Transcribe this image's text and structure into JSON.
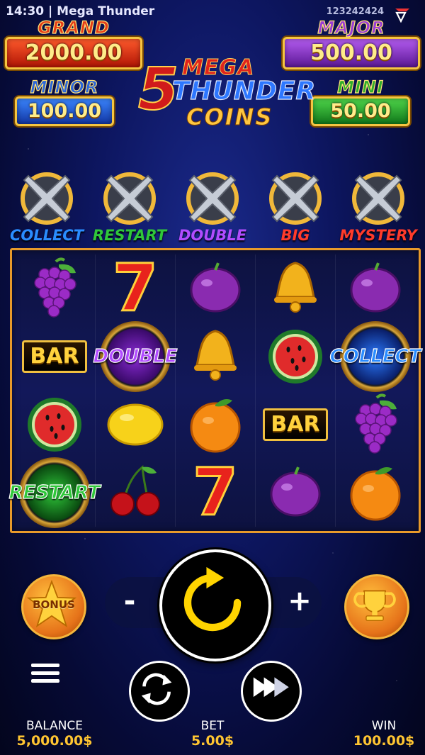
{
  "status_bar": {
    "time_title": "14:30 | Mega Thunder",
    "session_id": "123242424"
  },
  "jackpots": {
    "grand": {
      "label": "GRAND",
      "value": "2000.00",
      "color": "#e53b17"
    },
    "major": {
      "label": "MAJOR",
      "value": "500.00",
      "color": "#9a3cd6"
    },
    "minor": {
      "label": "MINOR",
      "value": "100.00",
      "color": "#2b66d9"
    },
    "mini": {
      "label": "MINI",
      "value": "50.00",
      "color": "#2fae2a"
    }
  },
  "game_logo": {
    "number": "5",
    "line1": "MEGA",
    "line2": "THUNDER",
    "line3": "COINS"
  },
  "features": [
    {
      "label": "COLLECT",
      "color": "#2a8cff"
    },
    {
      "label": "RESTART",
      "color": "#2fc73a"
    },
    {
      "label": "DOUBLE",
      "color": "#b14cff"
    },
    {
      "label": "BIG",
      "color": "#ff3b2b"
    },
    {
      "label": "MYSTERY",
      "color": "#ff3b2b"
    }
  ],
  "reels": [
    [
      "grapes",
      "bar",
      "watermelon",
      "restart-coin"
    ],
    [
      "seven",
      "double-coin",
      "lemon",
      "cherries"
    ],
    [
      "plum",
      "bell",
      "orange",
      "seven"
    ],
    [
      "bell",
      "watermelon",
      "bar",
      "plum"
    ],
    [
      "plum",
      "collect-coin",
      "grapes",
      "orange"
    ]
  ],
  "symbol_text": {
    "bar": "BAR",
    "seven": "7",
    "double": "DOUBLE",
    "collect": "COLLECT",
    "restart": "RESTART"
  },
  "controls": {
    "bonus_label": "BONUS",
    "minus": "-",
    "plus": "+"
  },
  "footer": {
    "balance_label": "BALANCE",
    "balance_value": "5,000.00$",
    "bet_label": "BET",
    "bet_value": "5.00$",
    "win_label": "WIN",
    "win_value": "100.00$"
  }
}
